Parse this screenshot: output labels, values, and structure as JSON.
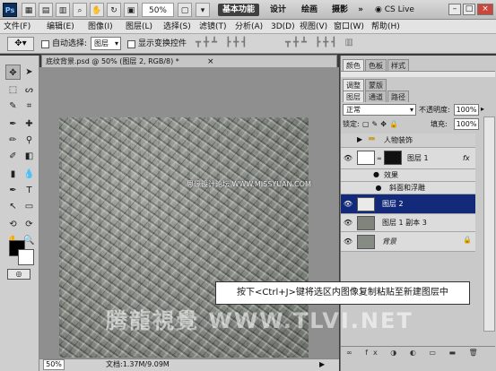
{
  "titlebar": {
    "logo": "Ps",
    "zoom_value": "50%",
    "workspaces": [
      "基本功能",
      "设计",
      "绘画",
      "摄影"
    ],
    "more": "»",
    "cs_live": "CS Live",
    "minimize": "–",
    "restore": "□",
    "close": "×"
  },
  "menu": {
    "items": [
      "文件(F)",
      "编辑(E)",
      "图像(I)",
      "图层(L)",
      "选择(S)",
      "滤镜(T)",
      "分析(A)",
      "3D(D)",
      "视图(V)",
      "窗口(W)",
      "帮助(H)"
    ]
  },
  "options": {
    "auto_select_label": "自动选择:",
    "auto_select_value": "图层",
    "show_transform_label": "显示变换控件"
  },
  "document": {
    "tab_title": "底纹背景.psd @ 50% (图层 2, RGB/8) *",
    "tab_close": "×",
    "watermark_top": "思缘设计论坛 WWW.MISSYUAN.COM",
    "watermark_bottom": "腾龍視覺 WWW.TLVI.NET"
  },
  "statusbar": {
    "zoom": "50%",
    "doc_info": "文档:1.37M/9.09M"
  },
  "panels": {
    "top_tabs": [
      "颜色",
      "色板",
      "样式"
    ],
    "mid_tabs": [
      "调整",
      "蒙版"
    ],
    "layer_tabs": [
      "图层",
      "通道",
      "路径"
    ],
    "blend_mode": "正常",
    "opacity_label": "不透明度:",
    "opacity_value": "100%",
    "lock_label": "锁定:",
    "fill_label": "填充:",
    "fill_value": "100%"
  },
  "layers": [
    {
      "name": "人物装饰",
      "type": "group"
    },
    {
      "name": "图层 1",
      "type": "layer",
      "fx": "fx"
    },
    {
      "name": "效果",
      "type": "effect-header"
    },
    {
      "name": "斜面和浮雕",
      "type": "effect"
    },
    {
      "name": "图层 2",
      "type": "layer",
      "selected": true
    },
    {
      "name": "图层 1 副本 3",
      "type": "layer"
    },
    {
      "name": "背景",
      "type": "background"
    }
  ],
  "caption": "按下<Ctrl+J>键将选区内图像复制粘贴至新建图层中",
  "colors": {
    "selected_layer": "#13297a",
    "foreground": "#000000",
    "background": "#ffffff"
  }
}
